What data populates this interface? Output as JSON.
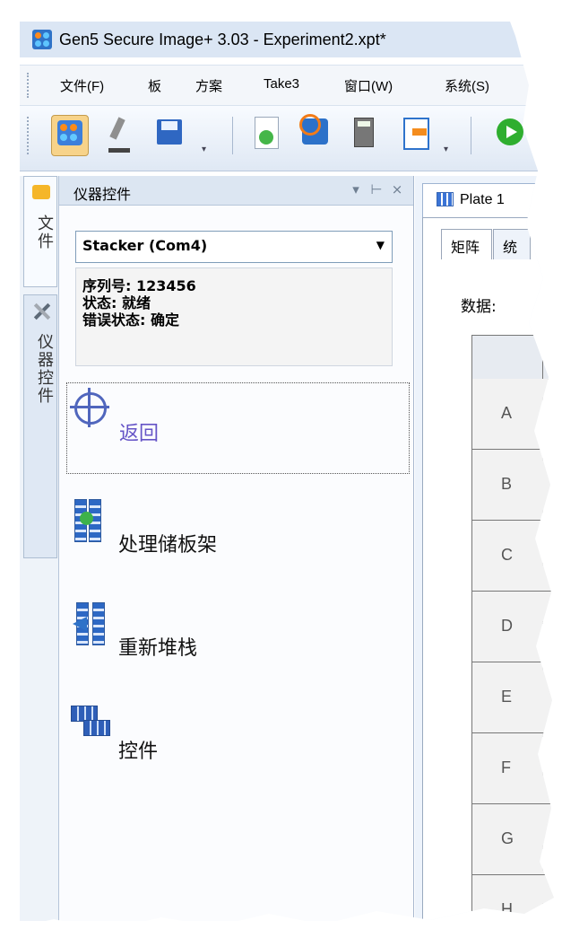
{
  "app": {
    "title": "Gen5 Secure Image+ 3.03 - Experiment2.xpt*"
  },
  "menu": {
    "items": [
      "文件(F)",
      "板",
      "方案",
      "Take3",
      "窗口(W)",
      "系统(S)"
    ]
  },
  "sidebar_tabs": {
    "files": "文件",
    "instrument_controls": "仪器控件"
  },
  "panel": {
    "title": "仪器控件",
    "device_select": "Stacker (Com4)",
    "serial": "序列号: 123456",
    "status": "状态: 就绪",
    "error_status": "错误状态: 确定"
  },
  "actions": {
    "return": "返回",
    "process_stack": "处理储板架",
    "restack": "重新堆栈",
    "control": "控件"
  },
  "plate": {
    "tab_label": "Plate 1",
    "tabs": [
      "矩阵",
      "统"
    ],
    "data_label": "数据:",
    "rows": [
      "A",
      "B",
      "C",
      "D",
      "E",
      "F",
      "G",
      "H"
    ]
  },
  "colors": {
    "title_bar": "#dbe6f4",
    "panel_header": "#dce6f2",
    "link": "#6655c7",
    "toolbar_active": "#f7d38a"
  }
}
